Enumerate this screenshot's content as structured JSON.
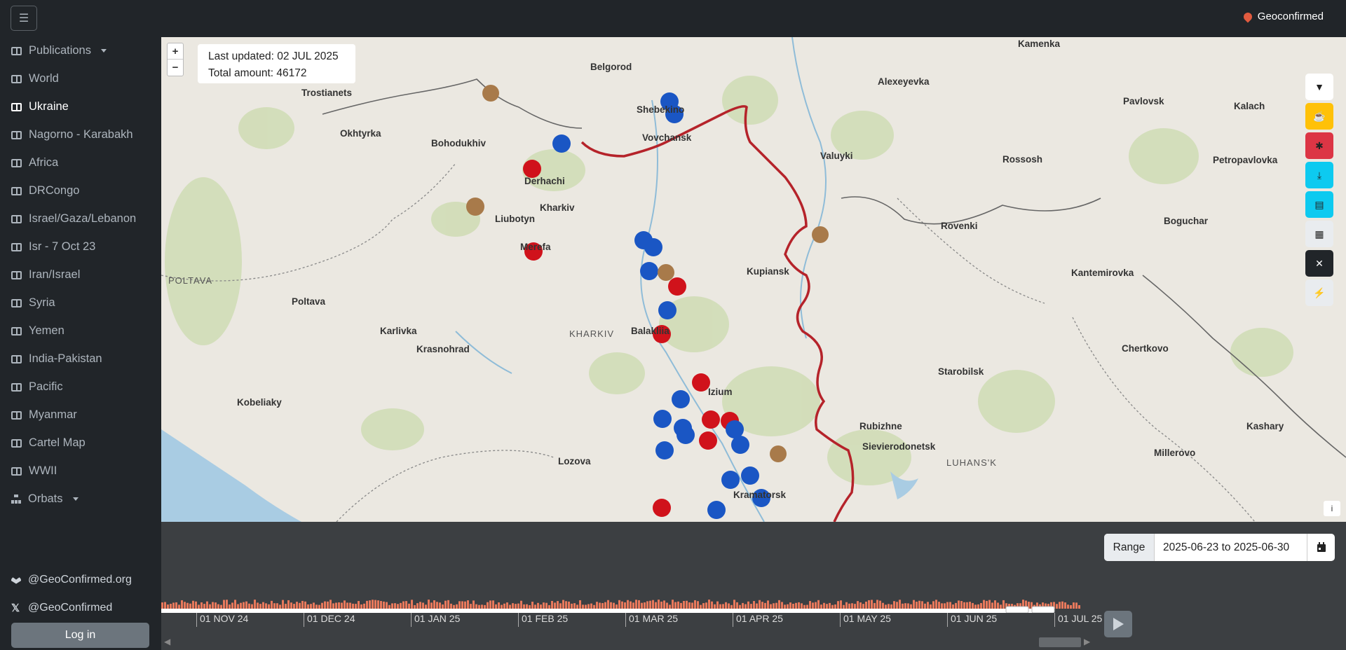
{
  "header": {
    "menu_icon": "hamburger-icon",
    "brand": "Geoconfirmed"
  },
  "sidebar": {
    "items": [
      {
        "label": "Publications",
        "icon": "book-icon",
        "dropdown": true
      },
      {
        "label": "World",
        "icon": "book-icon"
      },
      {
        "label": "Ukraine",
        "icon": "book-icon",
        "active": true
      },
      {
        "label": "Nagorno - Karabakh",
        "icon": "book-icon"
      },
      {
        "label": "Africa",
        "icon": "book-icon"
      },
      {
        "label": "DRCongo",
        "icon": "book-icon"
      },
      {
        "label": "Israel/Gaza/Lebanon",
        "icon": "book-icon"
      },
      {
        "label": "Isr - 7 Oct 23",
        "icon": "book-icon"
      },
      {
        "label": "Iran/Israel",
        "icon": "book-icon"
      },
      {
        "label": "Syria",
        "icon": "book-icon"
      },
      {
        "label": "Yemen",
        "icon": "book-icon"
      },
      {
        "label": "India-Pakistan",
        "icon": "book-icon"
      },
      {
        "label": "Pacific",
        "icon": "book-icon"
      },
      {
        "label": "Myanmar",
        "icon": "book-icon"
      },
      {
        "label": "Cartel Map",
        "icon": "book-icon"
      },
      {
        "label": "WWII",
        "icon": "book-icon"
      },
      {
        "label": "Orbats",
        "icon": "sitemap-icon",
        "dropdown": true
      }
    ],
    "social": [
      {
        "label": "@GeoConfirmed.org",
        "icon": "bluesky-icon"
      },
      {
        "label": "@GeoConfirmed",
        "icon": "x-icon"
      }
    ],
    "login_label": "Log in"
  },
  "map": {
    "zoom_in": "+",
    "zoom_out": "−",
    "last_updated": "Last updated: 02 JUL 2025",
    "total_amount": "Total amount: 46172",
    "info": "i",
    "cities": [
      "Belgorod",
      "Shebekino",
      "Okhtyrka",
      "Bohodukhiv",
      "Derhachi",
      "Kharkiv",
      "Liubotyn",
      "Merefa",
      "Poltava",
      "Karlivka",
      "Krasnohrad",
      "Balakliia",
      "Izium",
      "Kramatorsk",
      "Lozova",
      "Kobeliaky",
      "Valuyki",
      "Alexeyevka",
      "Rossosh",
      "Pavlovsk",
      "Kalach",
      "Petropavlovka",
      "Boguchar",
      "Rovenki",
      "Kantemirovka",
      "Starobilsk",
      "Chertkovo",
      "Millerovo",
      "Kashary",
      "Rubizhne",
      "Sievierodonetsk",
      "Trostianets",
      "Kupiansk",
      "Vovchansk",
      "Kamenka"
    ],
    "regions": [
      "POLTAVA",
      "KHARKIV",
      "LUHANS'K"
    ]
  },
  "tools": [
    {
      "icon": "filter-icon",
      "color": "#ffffff"
    },
    {
      "icon": "coffee-icon",
      "color": "#ffc107"
    },
    {
      "icon": "bug-icon",
      "color": "#dc3545"
    },
    {
      "icon": "download-icon",
      "color": "#0dcaf0"
    },
    {
      "icon": "file-download-icon",
      "color": "#0dcaf0"
    },
    {
      "icon": "map-icon",
      "color": "#e9ecef"
    },
    {
      "icon": "tools-icon",
      "color": "#212529"
    },
    {
      "icon": "bolt-icon",
      "color": "#e9ecef"
    }
  ],
  "range": {
    "label": "Range",
    "value": "2025-06-23 to 2025-06-30",
    "icon": "calendar-icon"
  },
  "timeline": {
    "ticks": [
      "01 NOV 24",
      "01 DEC 24",
      "01 JAN 25",
      "01 FEB 25",
      "01 MAR 25",
      "01 APR 25",
      "01 MAY 25",
      "01 JUN 25",
      "01 JUL 25"
    ],
    "bar_color": "#e8795c"
  }
}
